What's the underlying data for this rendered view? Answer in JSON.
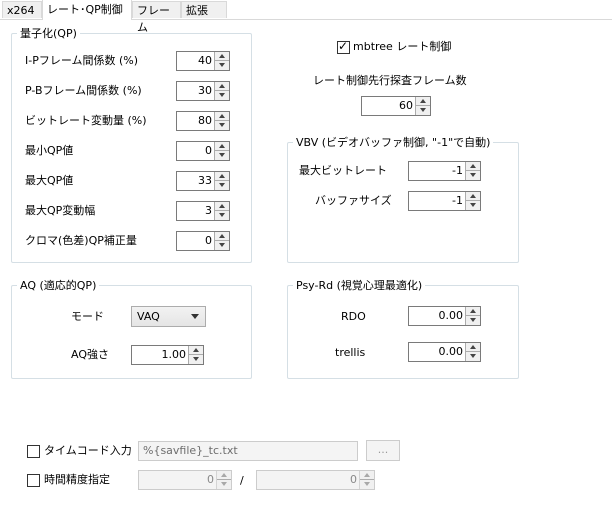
{
  "tabs": [
    "x264",
    "レート･QP制御",
    "フレーム",
    "拡張"
  ],
  "qp_group": {
    "title": "量子化(QP)",
    "rows": [
      {
        "label": "I-Pフレーム間係数 (%)",
        "value": "40"
      },
      {
        "label": "P-Bフレーム間係数 (%)",
        "value": "30"
      },
      {
        "label": "ビットレート変動量 (%)",
        "value": "80"
      },
      {
        "label": "最小QP値",
        "value": "0"
      },
      {
        "label": "最大QP値",
        "value": "33"
      },
      {
        "label": "最大QP変動幅",
        "value": "3"
      },
      {
        "label": "クロマ(色差)QP補正量",
        "value": "0"
      }
    ]
  },
  "mbtree": {
    "label": "mbtree レート制御",
    "checked": true
  },
  "lookahead": {
    "label": "レート制御先行探査フレーム数",
    "value": "60"
  },
  "vbv_group": {
    "title": "VBV (ビデオバッファ制御, \"-1\"で自動)",
    "max_bitrate_label": "最大ビットレート",
    "max_bitrate_value": "-1",
    "buffer_size_label": "バッファサイズ",
    "buffer_size_value": "-1"
  },
  "aq_group": {
    "title": "AQ (適応的QP)",
    "mode_label": "モード",
    "mode_value": "VAQ",
    "strength_label": "AQ強さ",
    "strength_value": "1.00"
  },
  "psy_group": {
    "title": "Psy-Rd (視覚心理最適化)",
    "rdo_label": "RDO",
    "rdo_value": "0.00",
    "trellis_label": "trellis",
    "trellis_value": "0.00"
  },
  "timecode": {
    "label": "タイムコード入力",
    "checked": false,
    "path": "%{savfile}_tc.txt",
    "browse_label": "..."
  },
  "time_precision": {
    "label": "時間精度指定",
    "checked": false,
    "numerator": "0",
    "separator": "/",
    "denominator": "0"
  }
}
